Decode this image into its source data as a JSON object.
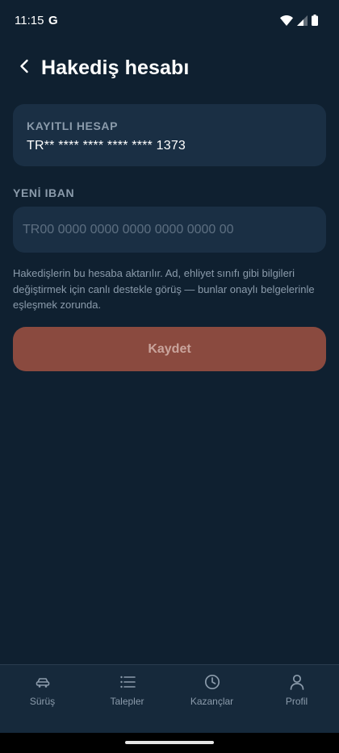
{
  "status_bar": {
    "time": "11:15",
    "google_glyph": "G"
  },
  "header": {
    "title": "Hakediş hesabı"
  },
  "saved_account": {
    "label": "KAYITLI HESAP",
    "value": "TR** **** **** **** **** 1373"
  },
  "new_iban": {
    "label": "YENİ IBAN",
    "value": "",
    "placeholder": "TR00 0000 0000 0000 0000 0000 00"
  },
  "help_text": "Hakedişlerin bu hesaba aktarılır. Ad, ehliyet sınıfı gibi bilgileri değiştirmek için canlı destekle görüş — bunlar onaylı belgelerinle eşleşmek zorunda.",
  "save_button": {
    "label": "Kaydet"
  },
  "bottom_nav": {
    "items": [
      {
        "label": "Sürüş",
        "icon": "car-icon"
      },
      {
        "label": "Talepler",
        "icon": "list-icon"
      },
      {
        "label": "Kazançlar",
        "icon": "clock-icon"
      },
      {
        "label": "Profil",
        "icon": "person-icon"
      }
    ]
  },
  "colors": {
    "background": "#0f2030",
    "card": "#1a2f44",
    "muted_text": "#8b9bab",
    "button": "#8a4a3f",
    "button_text": "#c9a49c",
    "nav_background": "#16293b"
  }
}
